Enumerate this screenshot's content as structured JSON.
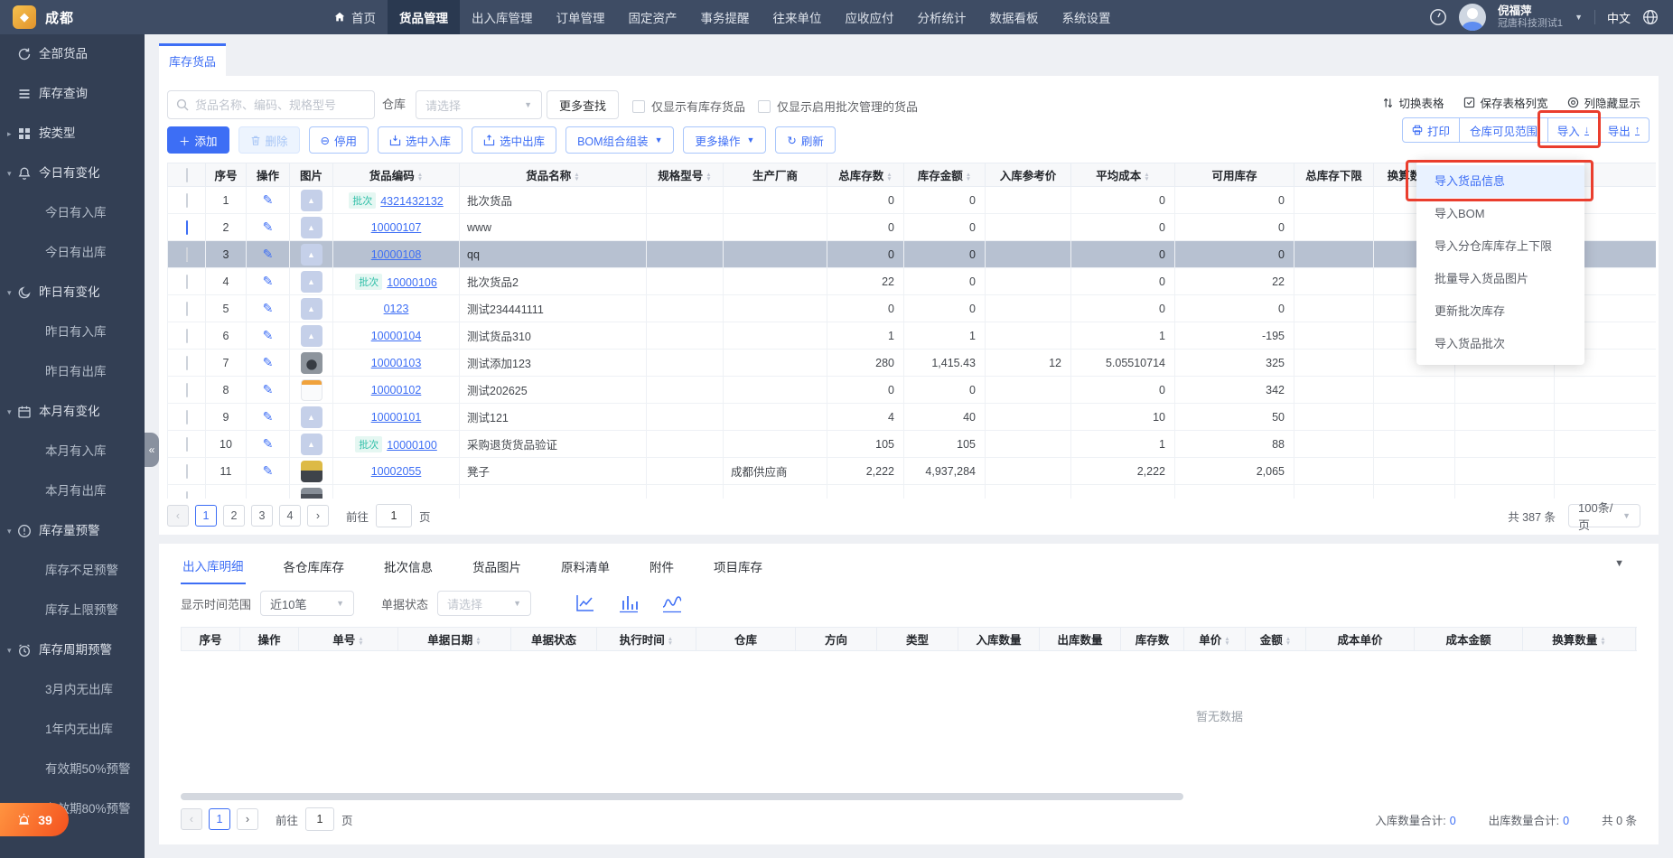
{
  "topnav": {
    "logo_text": "成都",
    "items": [
      {
        "label": "首页",
        "home": true
      },
      {
        "label": "货品管理",
        "active": true
      },
      {
        "label": "出入库管理"
      },
      {
        "label": "订单管理"
      },
      {
        "label": "固定资产"
      },
      {
        "label": "事务提醒"
      },
      {
        "label": "往来单位"
      },
      {
        "label": "应收应付"
      },
      {
        "label": "分析统计"
      },
      {
        "label": "数据看板"
      },
      {
        "label": "系统设置"
      }
    ],
    "user": {
      "name": "倪福萍",
      "org": "冠唐科技测试1"
    },
    "lang_label": "中文"
  },
  "sidebar": {
    "badge_count": "39",
    "items": [
      {
        "label": "全部货品",
        "icon_sync": true
      },
      {
        "label": "库存查询",
        "icon_list": true
      },
      {
        "label": "按类型",
        "icon_grid": true,
        "caret": "▸"
      },
      {
        "label": "今日有变化",
        "icon_bell": true,
        "caret": "▾"
      },
      {
        "label": "今日有入库",
        "sub": true
      },
      {
        "label": "今日有出库",
        "sub": true
      },
      {
        "label": "昨日有变化",
        "icon_moon": true,
        "caret": "▾"
      },
      {
        "label": "昨日有入库",
        "sub": true
      },
      {
        "label": "昨日有出库",
        "sub": true
      },
      {
        "label": "本月有变化",
        "icon_cal": true,
        "caret": "▾"
      },
      {
        "label": "本月有入库",
        "sub": true
      },
      {
        "label": "本月有出库",
        "sub": true
      },
      {
        "label": "库存量预警",
        "icon_warn": true,
        "caret": "▾"
      },
      {
        "label": "库存不足预警",
        "sub": true
      },
      {
        "label": "库存上限预警",
        "sub": true
      },
      {
        "label": "库存周期预警",
        "icon_clock": true,
        "caret": "▾"
      },
      {
        "label": "3月内无出库",
        "sub": true
      },
      {
        "label": "1年内无出库",
        "sub": true
      },
      {
        "label": "有效期50%预警",
        "sub": true
      },
      {
        "label": "有效期80%预警",
        "sub": true
      }
    ]
  },
  "content": {
    "tab": "库存货品",
    "search_placeholder": "货品名称、编码、规格型号",
    "warehouse_label": "仓库",
    "select_placeholder": "请选择",
    "more_search": "更多查找",
    "only_stock": "仅显示有库存货品",
    "only_batch": "仅显示启用批次管理的货品",
    "tools": {
      "switch": "切换表格",
      "save": "保存表格列宽",
      "columns": "列隐藏显示"
    },
    "buttons": {
      "add": "添加",
      "del": "删除",
      "disable": "停用",
      "in": "选中入库",
      "out": "选中出库",
      "bom": "BOM组合组装",
      "more": "更多操作",
      "refresh": "刷新"
    },
    "right_buttons": {
      "print": "打印",
      "scope": "仓库可见范围",
      "import": "导入",
      "export": "导出"
    },
    "import_menu": [
      {
        "label": "导入货品信息",
        "active": true
      },
      {
        "label": "导入BOM"
      },
      {
        "label": "导入分仓库库存上下限"
      },
      {
        "label": "批量导入货品图片"
      },
      {
        "label": "更新批次库存"
      },
      {
        "label": "导入货品批次"
      }
    ],
    "table": {
      "headers": [
        {
          "label": "序号"
        },
        {
          "label": "操作"
        },
        {
          "label": "图片"
        },
        {
          "label": "货品编码",
          "sort": true
        },
        {
          "label": "货品名称",
          "sort": true
        },
        {
          "label": "规格型号",
          "sort": true
        },
        {
          "label": "生产厂商"
        },
        {
          "label": "总库存数",
          "sort": true
        },
        {
          "label": "库存金额",
          "sort": true
        },
        {
          "label": "入库参考价"
        },
        {
          "label": "平均成本",
          "sort": true
        },
        {
          "label": "可用库存"
        },
        {
          "label": "总库存下限"
        },
        {
          "label": "换算数量",
          "sort": true
        },
        {
          "label": ""
        },
        {
          "label": ""
        }
      ],
      "rows": [
        {
          "num": "1",
          "batch": true,
          "tag": "批次",
          "code": "4321432132",
          "name": "批次货品",
          "spec": "",
          "mfr": "",
          "total": "0",
          "amount": "0",
          "ref": "",
          "avg": "0",
          "avail": "0",
          "img": "ph"
        },
        {
          "num": "2",
          "code": "10000107",
          "name": "www",
          "spec": "",
          "mfr": "",
          "total": "0",
          "amount": "0",
          "ref": "",
          "avg": "0",
          "avail": "0",
          "img": "ph",
          "cbh": true
        },
        {
          "num": "3",
          "code": "10000108",
          "name": "qq",
          "spec": "",
          "mfr": "",
          "total": "0",
          "amount": "0",
          "ref": "",
          "avg": "0",
          "avail": "0",
          "img": "ph",
          "selected": true
        },
        {
          "num": "4",
          "batch": true,
          "tag": "批次",
          "code": "10000106",
          "name": "批次货品2",
          "spec": "",
          "mfr": "",
          "total": "22",
          "amount": "0",
          "ref": "",
          "avg": "0",
          "avail": "22",
          "img": "ph"
        },
        {
          "num": "5",
          "code": "0123",
          "name": "测试234441111",
          "spec": "",
          "mfr": "",
          "total": "0",
          "amount": "0",
          "ref": "",
          "avg": "0",
          "avail": "0",
          "img": "ph"
        },
        {
          "num": "6",
          "code": "10000104",
          "name": "测试货品310",
          "spec": "",
          "mfr": "",
          "total": "1",
          "amount": "1",
          "ref": "",
          "avg": "1",
          "avail": "-195",
          "img": "ph"
        },
        {
          "num": "7",
          "code": "10000103",
          "name": "测试添加123",
          "spec": "",
          "mfr": "",
          "total": "280",
          "amount": "1,415.43",
          "ref": "12",
          "avg": "5.05510714",
          "avail": "325",
          "img": "runner"
        },
        {
          "num": "8",
          "code": "10000102",
          "name": "测试202625",
          "spec": "",
          "mfr": "",
          "total": "0",
          "amount": "0",
          "ref": "",
          "avg": "0",
          "avail": "342",
          "img": "receipt"
        },
        {
          "num": "9",
          "code": "10000101",
          "name": "测试121",
          "spec": "",
          "mfr": "",
          "total": "4",
          "amount": "40",
          "ref": "",
          "avg": "10",
          "avail": "50",
          "img": "ph"
        },
        {
          "num": "10",
          "batch": true,
          "tag": "批次",
          "code": "10000100",
          "name": "采购退货货品验证",
          "spec": "",
          "mfr": "",
          "total": "105",
          "amount": "105",
          "ref": "",
          "avg": "1",
          "avail": "88",
          "img": "ph"
        },
        {
          "num": "11",
          "code": "10002055",
          "name": "凳子",
          "spec": "",
          "mfr": "成都供应商",
          "total": "2,222",
          "amount": "4,937,284",
          "ref": "",
          "avg": "2,222",
          "avail": "2,065",
          "img": "stool"
        },
        {
          "num": "",
          "code": "",
          "name": "",
          "spec": "",
          "mfr": "",
          "total": "",
          "amount": "",
          "ref": "",
          "avg": "",
          "avail": "",
          "img": "dark",
          "nolink": true
        }
      ]
    },
    "pagination": {
      "pages": [
        {
          "label": "1",
          "active": true
        },
        {
          "label": "2"
        },
        {
          "label": "3"
        },
        {
          "label": "4"
        }
      ],
      "goto_label": "前往",
      "goto_value": "1",
      "page_label": "页",
      "total": "共 387 条",
      "size": "100条/页"
    }
  },
  "detail": {
    "tabs": [
      {
        "label": "出入库明细",
        "active": true
      },
      {
        "label": "各仓库库存"
      },
      {
        "label": "批次信息"
      },
      {
        "label": "货品图片"
      },
      {
        "label": "原料清单"
      },
      {
        "label": "附件"
      },
      {
        "label": "项目库存"
      }
    ],
    "time_label": "显示时间范围",
    "time_value": "近10笔",
    "status_label": "单据状态",
    "status_placeholder": "请选择",
    "headers": [
      {
        "label": "序号"
      },
      {
        "label": "操作"
      },
      {
        "label": "单号",
        "sort": true
      },
      {
        "label": "单据日期",
        "sort": true
      },
      {
        "label": "单据状态"
      },
      {
        "label": "执行时间",
        "sort": true
      },
      {
        "label": "仓库"
      },
      {
        "label": "方向"
      },
      {
        "label": "类型"
      },
      {
        "label": "入库数量"
      },
      {
        "label": "出库数量"
      },
      {
        "label": "库存数"
      },
      {
        "label": "单价",
        "sort": true
      },
      {
        "label": "金额",
        "sort": true
      },
      {
        "label": "成本单价"
      },
      {
        "label": "成本金额"
      },
      {
        "label": "换算数量",
        "sort": true
      },
      {
        "label": ""
      }
    ],
    "empty": "暂无数据",
    "footer": {
      "goto_label": "前往",
      "goto_value": "1",
      "page_label": "页",
      "in_label": "入库数量合计:",
      "in_value": "0",
      "out_label": "出库数量合计:",
      "out_value": "0",
      "total": "共 0 条"
    }
  }
}
